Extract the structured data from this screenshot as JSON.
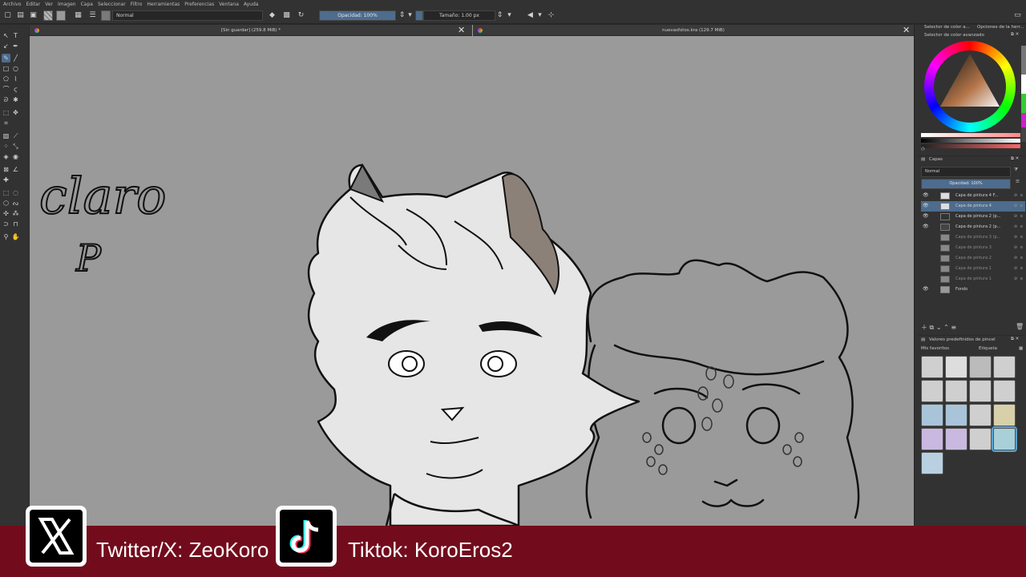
{
  "menu": [
    "Archivo",
    "Editar",
    "Ver",
    "Imagen",
    "Capa",
    "Seleccionar",
    "Filtro",
    "Herramientas",
    "Preferencias",
    "Ventana",
    "Ayuda"
  ],
  "toolbar": {
    "blend_mode": "Normal",
    "opacity_label": "Opacidad: 100%",
    "size_label": "Tamaño: 1.00 px"
  },
  "tabs": [
    {
      "title": "[Sin guardar]  (259.8 MiB) *"
    },
    {
      "title": "nuevasfotos.kra (129.7 MiB)"
    }
  ],
  "canvas": {
    "handwriting_line1": "claro",
    "handwriting_line2": "P"
  },
  "panels": {
    "top_tab_1": "Selector de color a...",
    "top_tab_2": "Opciones de la herr...",
    "color_selector_title": "Selector de color avanzado",
    "layers_title": "Capas",
    "layers_blend": "Normal",
    "layers_opacity": "Opacidad:  100%",
    "brush_presets_title": "Valores predefinidos de pincel",
    "brush_filter": "Mis favoritos",
    "brush_tag": "Etiqueta"
  },
  "layers": [
    {
      "name": "Capa de pintura 4 F...",
      "visible": true,
      "selected": false
    },
    {
      "name": "Capa de pintura 4",
      "visible": true,
      "selected": true
    },
    {
      "name": "Capa de pintura 2 (p...",
      "visible": true,
      "selected": false
    },
    {
      "name": "Capa de pintura 2 (p...",
      "visible": true,
      "selected": false
    },
    {
      "name": "Capa de pintura 3 (p...",
      "visible": false,
      "selected": false
    },
    {
      "name": "Capa de pintura 3",
      "visible": false,
      "selected": false
    },
    {
      "name": "Capa de pintura 2",
      "visible": false,
      "selected": false
    },
    {
      "name": "Capa de pintura 1",
      "visible": false,
      "selected": false
    },
    {
      "name": "Capa de pintura 1",
      "visible": false,
      "selected": false
    },
    {
      "name": "Fondo",
      "visible": true,
      "selected": false
    }
  ],
  "banner": {
    "twitter_text": "Twitter/X: ZeoKoro",
    "tiktok_text": "Tiktok: KoroEros2"
  },
  "colors": {
    "accent": "#4d6c8e",
    "banner_bg": "#720c1c",
    "canvas_bg": "#9a9a9a"
  }
}
